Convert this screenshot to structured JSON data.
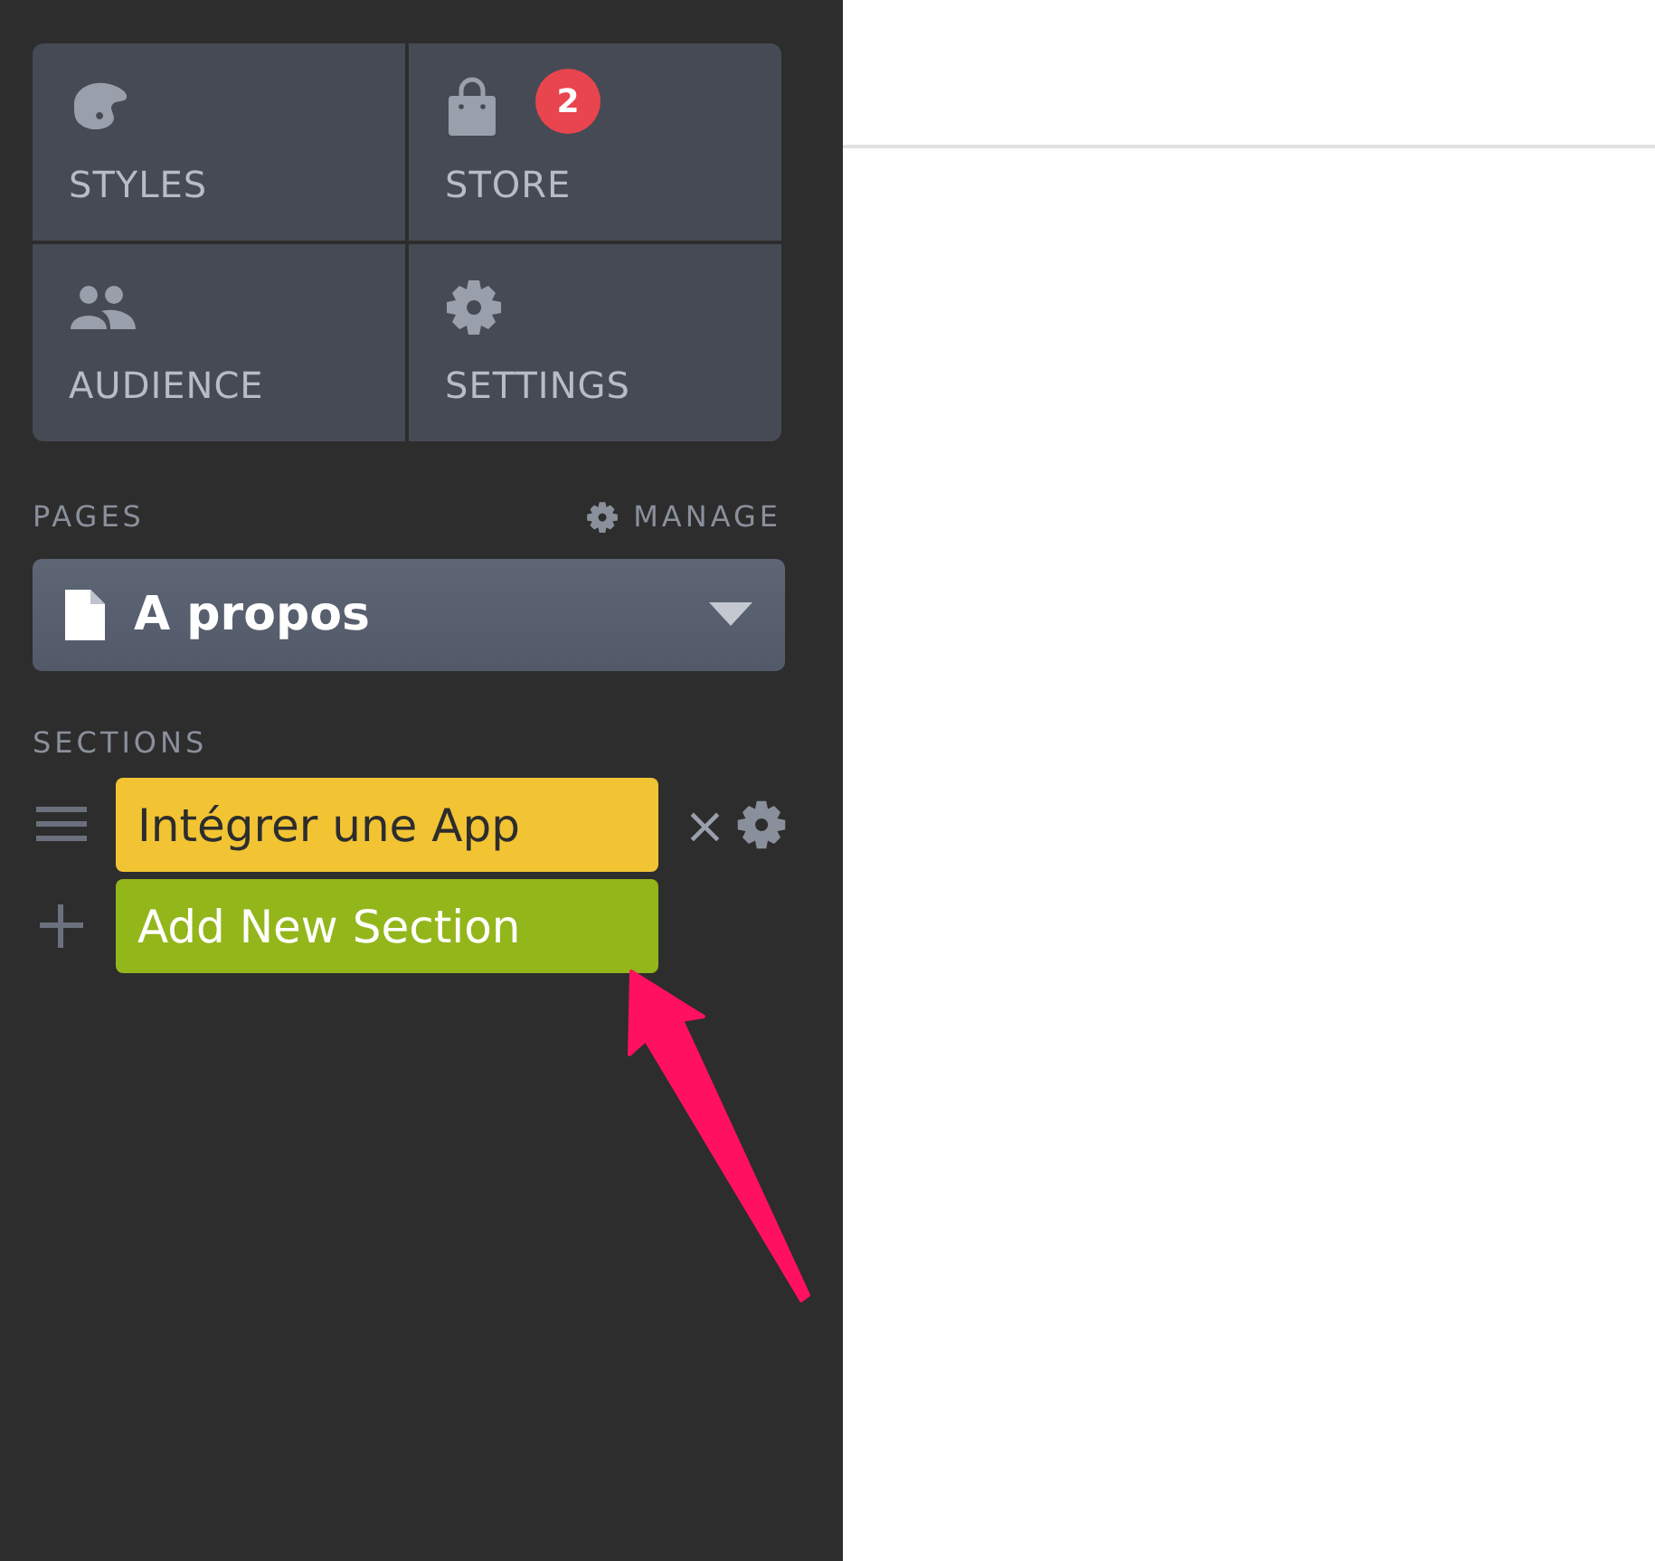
{
  "tiles": [
    {
      "label": "STYLES",
      "kind": "styles"
    },
    {
      "label": "STORE",
      "kind": "store"
    },
    {
      "label": "AUDIENCE",
      "kind": "audience"
    },
    {
      "label": "SETTINGS",
      "kind": "settings"
    }
  ],
  "store_badge": "2",
  "pages": {
    "heading": "PAGES",
    "manage": "MANAGE",
    "current": "A propos"
  },
  "sections": {
    "heading": "SECTIONS",
    "items": [
      {
        "kind": "section",
        "label": "Intégrer une App",
        "remove": "×"
      },
      {
        "kind": "add",
        "label": "Add New Section"
      }
    ]
  }
}
